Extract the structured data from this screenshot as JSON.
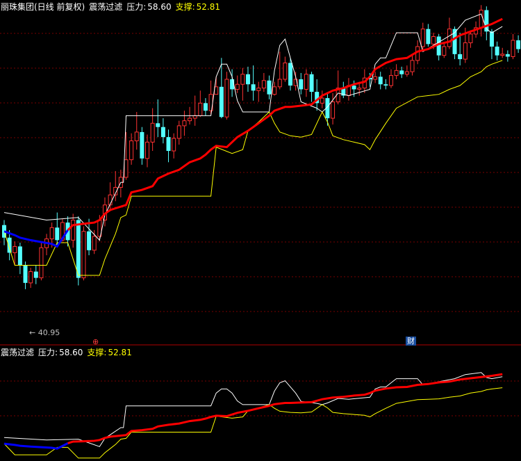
{
  "header": {
    "stock_title": "丽珠集团(日线 前复权)",
    "indicator_name": "震荡过滤",
    "pressure_label": "压力:",
    "pressure_value": "58.60",
    "support_label": "支撑:",
    "support_value": "52.81"
  },
  "sub_header": {
    "indicator_name": "震荡过滤",
    "pressure_label": "压力:",
    "pressure_value": "58.60",
    "support_label": "支撑:",
    "support_value": "52.81"
  },
  "low_marker": {
    "label": "← 40.95"
  },
  "markers": {
    "finance_badge": "财",
    "event_badge": "⊕"
  },
  "colors": {
    "background": "#000000",
    "bull_candle": "#ff3232",
    "bear_candle": "#54ffff",
    "pressure_line": "#ffffff",
    "support_line": "#ffff00",
    "trend_up": "#ff0000",
    "trend_down": "#0000ff",
    "grid": "#7a0000",
    "divider": "#b00000"
  },
  "chart_data": {
    "type": "candlestick",
    "price_range": [
      39,
      65
    ],
    "candles": [
      [
        48.2,
        47.2,
        48.6,
        46.6
      ],
      [
        47.2,
        46.0,
        47.8,
        45.4
      ],
      [
        46.0,
        46.5,
        46.9,
        45.0
      ],
      [
        46.5,
        45.0,
        46.8,
        44.3
      ],
      [
        45.0,
        43.6,
        45.3,
        43.1
      ],
      [
        43.6,
        44.5,
        44.8,
        43.2
      ],
      [
        44.5,
        44.0,
        45.0,
        43.5
      ],
      [
        44.0,
        46.4,
        46.8,
        43.8
      ],
      [
        46.4,
        47.1,
        47.5,
        45.8
      ],
      [
        47.1,
        48.0,
        48.4,
        46.4
      ],
      [
        48.0,
        47.0,
        49.2,
        46.6
      ],
      [
        47.0,
        48.4,
        48.7,
        46.9
      ],
      [
        48.4,
        47.0,
        48.9,
        46.5
      ],
      [
        47.0,
        48.6,
        49.1,
        46.4
      ],
      [
        48.6,
        44.0,
        48.9,
        43.4
      ],
      [
        44.0,
        47.7,
        48.1,
        43.8
      ],
      [
        47.7,
        46.2,
        48.7,
        45.8
      ],
      [
        46.2,
        47.3,
        47.8,
        45.9
      ],
      [
        47.3,
        48.6,
        49.0,
        46.9
      ],
      [
        48.6,
        49.8,
        50.4,
        48.1
      ],
      [
        49.8,
        50.6,
        51.6,
        49.3
      ],
      [
        50.6,
        51.2,
        52.5,
        50.1
      ],
      [
        51.2,
        52.0,
        52.6,
        50.4
      ],
      [
        52.0,
        53.4,
        55.6,
        51.8
      ],
      [
        53.4,
        54.9,
        55.5,
        53.0
      ],
      [
        54.9,
        55.6,
        57.2,
        54.2
      ],
      [
        55.6,
        53.5,
        56.0,
        53.0
      ],
      [
        53.5,
        54.8,
        55.4,
        52.8
      ],
      [
        54.8,
        56.3,
        57.5,
        54.1
      ],
      [
        56.3,
        56.0,
        58.2,
        55.2
      ],
      [
        56.0,
        55.2,
        56.7,
        54.7
      ],
      [
        55.2,
        54.1,
        55.8,
        53.2
      ],
      [
        54.1,
        55.1,
        55.5,
        53.5
      ],
      [
        55.1,
        56.1,
        56.5,
        54.6
      ],
      [
        56.1,
        56.5,
        57.3,
        55.3
      ],
      [
        56.5,
        56.7,
        57.6,
        56.2
      ],
      [
        56.7,
        56.9,
        58.5,
        56.1
      ],
      [
        56.9,
        57.9,
        58.9,
        56.8
      ],
      [
        57.9,
        57.3,
        58.3,
        56.9
      ],
      [
        57.3,
        58.6,
        59.7,
        57.0
      ],
      [
        58.6,
        59.2,
        60.0,
        58.6
      ],
      [
        59.2,
        56.8,
        61.5,
        56.7
      ],
      [
        56.8,
        59.8,
        60.4,
        56.6
      ],
      [
        59.8,
        59.0,
        60.6,
        58.4
      ],
      [
        59.0,
        59.4,
        60.1,
        58.7
      ],
      [
        59.4,
        60.2,
        60.7,
        58.1
      ],
      [
        60.2,
        59.4,
        60.8,
        58.8
      ],
      [
        59.4,
        58.9,
        60.9,
        58.1
      ],
      [
        58.9,
        59.1,
        59.6,
        58.0
      ],
      [
        59.1,
        59.7,
        60.3,
        58.8
      ],
      [
        59.7,
        58.6,
        60.1,
        58.2
      ],
      [
        58.6,
        59.2,
        59.6,
        58.5
      ],
      [
        59.2,
        59.8,
        62.0,
        59.0
      ],
      [
        59.8,
        61.1,
        61.6,
        59.6
      ],
      [
        61.1,
        59.3,
        61.5,
        58.9
      ],
      [
        59.3,
        59.8,
        60.4,
        58.9
      ],
      [
        59.8,
        59.0,
        60.3,
        58.6
      ],
      [
        59.0,
        60.2,
        60.6,
        58.4
      ],
      [
        60.2,
        58.8,
        60.4,
        58.0
      ],
      [
        58.8,
        57.9,
        59.8,
        57.3
      ],
      [
        57.9,
        58.3,
        58.9,
        57.5
      ],
      [
        58.3,
        56.7,
        58.7,
        56.1
      ],
      [
        56.7,
        58.0,
        58.7,
        56.2
      ],
      [
        58.0,
        59.1,
        60.5,
        57.8
      ],
      [
        59.1,
        58.5,
        59.6,
        58.3
      ],
      [
        58.5,
        59.3,
        59.9,
        58.1
      ],
      [
        59.3,
        59.0,
        59.7,
        58.4
      ],
      [
        59.0,
        59.1,
        59.6,
        58.5
      ],
      [
        59.1,
        59.9,
        60.6,
        58.7
      ],
      [
        59.9,
        59.8,
        60.3,
        59.2
      ],
      [
        59.8,
        60.0,
        60.4,
        59.5
      ],
      [
        60.0,
        59.4,
        60.4,
        59.0
      ],
      [
        59.4,
        59.3,
        59.8,
        59.0
      ],
      [
        59.3,
        60.1,
        60.6,
        59.1
      ],
      [
        60.1,
        60.5,
        61.0,
        59.8
      ],
      [
        60.5,
        60.2,
        60.8,
        59.9
      ],
      [
        60.2,
        60.4,
        60.9,
        60.0
      ],
      [
        60.4,
        61.3,
        61.8,
        60.1
      ],
      [
        61.3,
        62.4,
        62.9,
        61.0
      ],
      [
        62.4,
        63.8,
        64.3,
        62.1
      ],
      [
        63.8,
        62.6,
        64.2,
        62.4
      ],
      [
        62.6,
        63.2,
        63.5,
        62.2
      ],
      [
        63.2,
        61.7,
        63.4,
        61.3
      ],
      [
        61.7,
        62.4,
        62.7,
        61.5
      ],
      [
        62.4,
        63.8,
        64.7,
        62.2
      ],
      [
        63.8,
        61.8,
        64.0,
        61.4
      ],
      [
        61.8,
        61.4,
        63.5,
        60.9
      ],
      [
        61.4,
        62.7,
        63.9,
        61.1
      ],
      [
        62.7,
        63.4,
        63.7,
        62.3
      ],
      [
        63.4,
        63.9,
        64.4,
        63.1
      ],
      [
        63.9,
        65.3,
        65.7,
        63.2
      ],
      [
        65.3,
        63.6,
        65.6,
        62.9
      ],
      [
        63.6,
        62.4,
        63.8,
        61.4
      ],
      [
        62.4,
        61.7,
        62.8,
        61.3
      ],
      [
        61.7,
        61.8,
        62.3,
        61.5
      ],
      [
        61.8,
        61.6,
        62.1,
        61.2
      ],
      [
        61.6,
        62.9,
        63.4,
        61.4
      ],
      [
        62.9,
        62.2,
        63.3,
        61.9
      ],
      [
        62.2,
        62.5,
        63.6,
        62.0
      ],
      [
        62.5,
        63.9,
        64.6,
        62.1
      ],
      [
        63.9,
        64.2,
        65.0,
        63.6
      ],
      [
        64.2,
        65.8,
        66.6,
        64.0
      ],
      [
        65.8,
        66.9,
        67.5,
        65.5
      ],
      [
        66.9,
        67.2,
        67.7,
        66.4
      ],
      [
        67.2,
        66.8,
        67.6,
        66.3
      ],
      [
        66.8,
        67.5,
        68.1,
        66.6
      ],
      [
        67.5,
        66.7,
        67.8,
        66.2
      ],
      [
        66.7,
        67.9,
        68.6,
        66.5
      ],
      [
        67.9,
        68.5,
        69.1,
        67.7
      ],
      [
        68.5,
        68.7,
        69.5,
        68.1
      ]
    ],
    "pressure_line": [
      [
        0,
        49.2
      ],
      [
        8,
        48.6
      ],
      [
        14,
        48.8
      ],
      [
        18,
        47.0
      ],
      [
        19,
        49.0
      ],
      [
        22,
        51.6
      ],
      [
        22.5,
        51.6
      ],
      [
        23,
        56.9
      ],
      [
        39,
        56.9
      ],
      [
        40,
        60.0
      ],
      [
        41,
        61.0
      ],
      [
        42,
        61.0
      ],
      [
        43,
        60.0
      ],
      [
        44,
        58.1
      ],
      [
        45,
        57.2
      ],
      [
        50,
        57.2
      ],
      [
        51,
        60.5
      ],
      [
        52,
        62.5
      ],
      [
        53,
        63.0
      ],
      [
        55,
        60.0
      ],
      [
        56,
        58.0
      ],
      [
        59,
        57.5
      ],
      [
        60,
        57.2
      ],
      [
        61,
        57.6
      ],
      [
        63,
        58.7
      ],
      [
        65,
        58.5
      ],
      [
        69,
        59.0
      ],
      [
        70,
        61.0
      ],
      [
        71,
        61.5
      ],
      [
        72,
        61.5
      ],
      [
        73,
        62.5
      ],
      [
        74,
        63.5
      ],
      [
        78,
        63.5
      ],
      [
        79,
        62.0
      ],
      [
        81,
        62.5
      ],
      [
        85,
        63.5
      ],
      [
        87,
        64.5
      ],
      [
        90,
        65.0
      ],
      [
        91,
        63.8
      ],
      [
        92,
        63.5
      ],
      [
        94,
        64.0
      ]
    ],
    "support_line": [
      [
        0,
        47.7
      ],
      [
        2,
        45.0
      ],
      [
        8,
        45.0
      ],
      [
        10,
        46.8
      ],
      [
        12,
        46.8
      ],
      [
        14,
        44.2
      ],
      [
        15,
        44.2
      ],
      [
        17,
        44.2
      ],
      [
        18,
        44.2
      ],
      [
        19,
        45.5
      ],
      [
        20,
        46.5
      ],
      [
        21,
        47.5
      ],
      [
        22,
        48.8
      ],
      [
        23,
        49.0
      ],
      [
        24,
        50.5
      ],
      [
        37,
        50.5
      ],
      [
        39,
        50.5
      ],
      [
        40,
        54.4
      ],
      [
        43,
        53.9
      ],
      [
        45,
        54.2
      ],
      [
        46,
        55.7
      ],
      [
        48,
        56.4
      ],
      [
        50,
        57.2
      ],
      [
        51,
        56.3
      ],
      [
        52,
        55.6
      ],
      [
        54,
        55.3
      ],
      [
        56,
        55.2
      ],
      [
        58,
        55.4
      ],
      [
        60,
        57.2
      ],
      [
        61,
        56.4
      ],
      [
        62,
        55.3
      ],
      [
        64,
        55.0
      ],
      [
        66,
        54.8
      ],
      [
        68,
        54.6
      ],
      [
        69,
        54.2
      ],
      [
        70,
        55.0
      ],
      [
        72,
        56.3
      ],
      [
        74,
        57.5
      ],
      [
        78,
        58.4
      ],
      [
        80,
        58.5
      ],
      [
        82,
        58.6
      ],
      [
        84,
        59.0
      ],
      [
        86,
        59.3
      ],
      [
        88,
        60.0
      ],
      [
        90,
        60.4
      ],
      [
        91,
        60.8
      ],
      [
        92,
        61.0
      ],
      [
        94,
        61.3
      ]
    ],
    "trend_line": [
      [
        0,
        47.7
      ],
      [
        2,
        47.4
      ],
      [
        3,
        47.2
      ],
      [
        5,
        47.0
      ],
      [
        9,
        46.7
      ],
      [
        10,
        46.5
      ],
      [
        12,
        47.8
      ],
      [
        13,
        48.2
      ],
      [
        15,
        48.3
      ],
      [
        17,
        48.4
      ],
      [
        18,
        48.6
      ],
      [
        19,
        49.1
      ],
      [
        20,
        49.4
      ],
      [
        23,
        49.8
      ],
      [
        24,
        50.8
      ],
      [
        26,
        51.0
      ],
      [
        28,
        51.3
      ],
      [
        29,
        51.9
      ],
      [
        31,
        52.3
      ],
      [
        33,
        52.6
      ],
      [
        35,
        53.2
      ],
      [
        37,
        53.5
      ],
      [
        38,
        53.8
      ],
      [
        39,
        54.2
      ],
      [
        40,
        54.5
      ],
      [
        42,
        54.4
      ],
      [
        44,
        55.2
      ],
      [
        46,
        55.7
      ],
      [
        48,
        56.3
      ],
      [
        50,
        56.9
      ],
      [
        51,
        57.3
      ],
      [
        53,
        57.6
      ],
      [
        54,
        57.6
      ],
      [
        56,
        57.7
      ],
      [
        58,
        57.8
      ],
      [
        60,
        58.5
      ],
      [
        62,
        58.9
      ],
      [
        64,
        59.1
      ],
      [
        66,
        59.4
      ],
      [
        68,
        59.6
      ],
      [
        69,
        60.0
      ],
      [
        70,
        60.6
      ],
      [
        72,
        61.1
      ],
      [
        74,
        61.4
      ],
      [
        76,
        61.5
      ],
      [
        78,
        62.0
      ],
      [
        80,
        62.2
      ],
      [
        82,
        62.6
      ],
      [
        84,
        62.8
      ],
      [
        86,
        63.3
      ],
      [
        88,
        63.6
      ],
      [
        90,
        63.9
      ],
      [
        92,
        64.2
      ],
      [
        94,
        64.6
      ]
    ],
    "trend_down_until": 12
  }
}
